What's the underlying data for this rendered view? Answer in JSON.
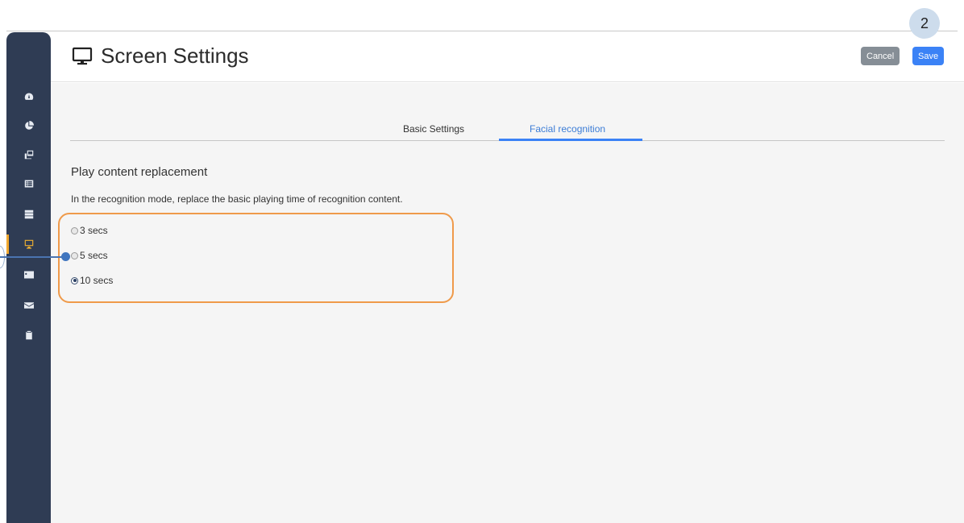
{
  "step_badge": "2",
  "header": {
    "title": "Screen Settings",
    "title_icon": "monitor-icon",
    "cancel_label": "Cancel",
    "save_label": "Save"
  },
  "sidebar": {
    "items": [
      {
        "icon": "dashboard-icon",
        "active": false
      },
      {
        "icon": "pie-chart-icon",
        "active": false
      },
      {
        "icon": "gallery-icon",
        "active": false
      },
      {
        "icon": "list-icon",
        "active": false
      },
      {
        "icon": "server-icon",
        "active": false
      },
      {
        "icon": "monitor-icon",
        "active": true
      },
      {
        "icon": "id-card-icon",
        "active": false
      },
      {
        "icon": "envelope-icon",
        "active": false
      },
      {
        "icon": "clipboard-icon",
        "active": false
      }
    ]
  },
  "tabs": [
    {
      "label": "Basic Settings",
      "active": false
    },
    {
      "label": "Facial recognition",
      "active": true
    }
  ],
  "section": {
    "title": "Play content replacement",
    "description": "In the recognition mode, replace the basic playing time of recognition content."
  },
  "options": [
    {
      "label": "3 secs",
      "checked": false
    },
    {
      "label": "5 secs",
      "checked": false
    },
    {
      "label": "10 secs",
      "checked": true
    }
  ],
  "colors": {
    "sidebar_bg": "#2f3c54",
    "accent": "#3b82f6",
    "active_marker": "#f0a830",
    "highlight_border": "#ef9a4a"
  }
}
